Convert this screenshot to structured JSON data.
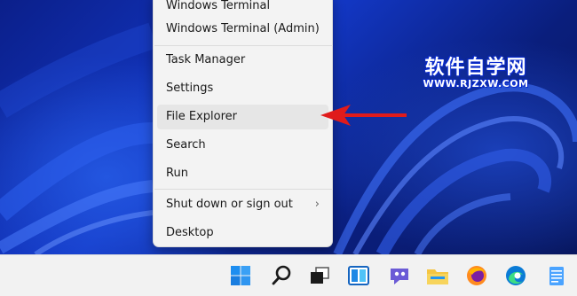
{
  "menu": {
    "items": [
      {
        "label": "Windows Terminal"
      },
      {
        "label": "Windows Terminal (Admin)"
      },
      {
        "label": "Task Manager"
      },
      {
        "label": "Settings"
      },
      {
        "label": "File Explorer"
      },
      {
        "label": "Search"
      },
      {
        "label": "Run"
      },
      {
        "label": "Shut down or sign out"
      },
      {
        "label": "Desktop"
      }
    ],
    "highlighted": "File Explorer"
  },
  "watermark": {
    "title": "软件自学网",
    "url": "WWW.RJZXW.COM"
  },
  "taskbar": {
    "icons": [
      "start-icon",
      "search-icon",
      "task-view-icon",
      "widgets-icon",
      "chat-icon",
      "file-explorer-icon",
      "firefox-icon",
      "edge-icon",
      "notepad-icon"
    ]
  },
  "colors": {
    "arrow": "#e01b1b",
    "accent": "#0067c0"
  }
}
